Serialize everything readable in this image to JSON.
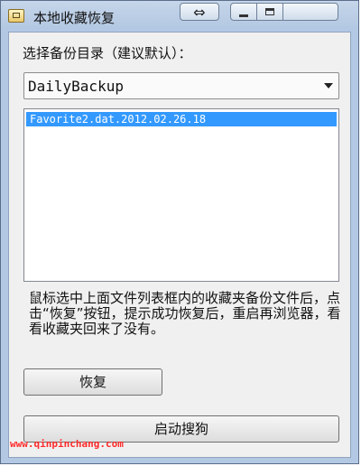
{
  "window": {
    "title": "本地收藏恢复",
    "resize_glyph": "⇔"
  },
  "form": {
    "select_label": "选择备份目录（建议默认）：",
    "selected_directory": "DailyBackup",
    "files": [
      "Favorite2.dat.2012.02.26.18"
    ],
    "hint": "鼠标选中上面文件列表框内的收藏夹备份文件后，点击“恢复”按钮，提示成功恢复后，重启再浏览器，看看收藏夹回来了没有。",
    "restore_label": "恢复",
    "launch_label": "启动搜狗"
  },
  "watermark": "www.qinpinchang.com",
  "icons": {
    "app": "folder-app-icon",
    "minimize": "minimize-icon",
    "maximize": "maximize-icon",
    "dropdown": "chevron-down-icon"
  },
  "colors": {
    "selection": "#3399ff",
    "watermark": "#ff2a2a",
    "titlebar": "#b3c8e2"
  }
}
